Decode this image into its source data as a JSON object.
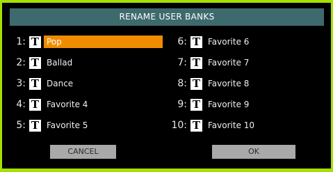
{
  "dialog": {
    "title": "RENAME USER BANKS"
  },
  "banks_left": [
    {
      "number": "1:",
      "name": "Pop",
      "selected": true
    },
    {
      "number": "2:",
      "name": "Ballad",
      "selected": false
    },
    {
      "number": "3:",
      "name": "Dance",
      "selected": false
    },
    {
      "number": "4:",
      "name": "Favorite 4",
      "selected": false
    },
    {
      "number": "5:",
      "name": "Favorite 5",
      "selected": false
    }
  ],
  "banks_right": [
    {
      "number": "6:",
      "name": "Favorite 6",
      "selected": false
    },
    {
      "number": "7:",
      "name": "Favorite 7",
      "selected": false
    },
    {
      "number": "8:",
      "name": "Favorite 8",
      "selected": false
    },
    {
      "number": "9:",
      "name": "Favorite 9",
      "selected": false
    },
    {
      "number": "10:",
      "name": "Favorite 10",
      "selected": false
    }
  ],
  "text_button_glyph": "T",
  "buttons": {
    "cancel_label": "CANCEL",
    "ok_label": "OK"
  },
  "colors": {
    "background": "#a6e000",
    "dialog": "#000000",
    "title_bar": "#3e6a6e",
    "selection": "#f08c00",
    "button": "#a9a9a9"
  },
  "icons": {
    "text_edit": "text-edit-icon"
  }
}
